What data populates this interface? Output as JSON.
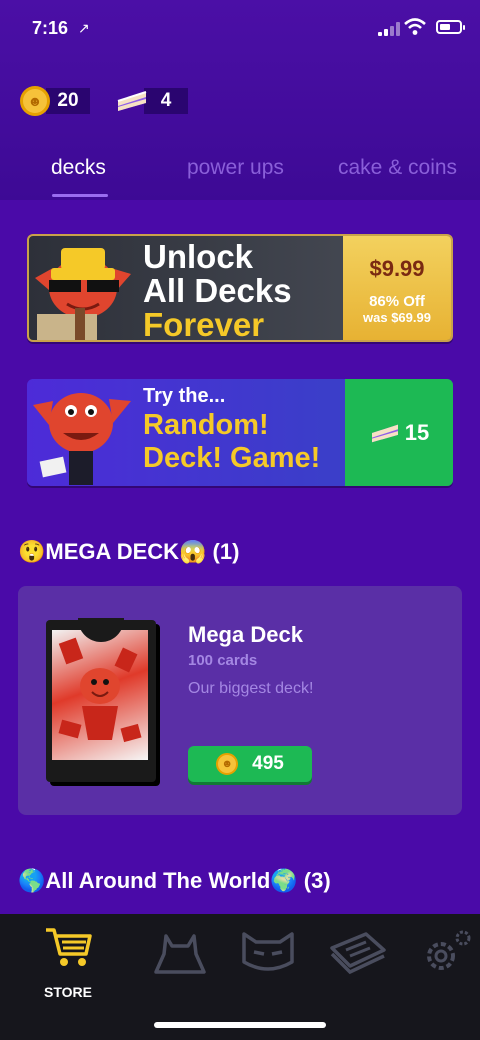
{
  "status_bar": {
    "time": "7:16",
    "location_glyph": "↗"
  },
  "currency": {
    "coins": "20",
    "cake": "4"
  },
  "tabs": [
    {
      "label": "decks",
      "active": true
    },
    {
      "label": "power ups",
      "active": false
    },
    {
      "label": "cake & coins",
      "active": false
    }
  ],
  "banner_unlock": {
    "line1": "Unlock",
    "line2": "All Decks",
    "line3": "Forever",
    "price": "$9.99",
    "discount": "86% Off",
    "was": "was $69.99"
  },
  "banner_random": {
    "try": "Try the...",
    "line1": "Random!",
    "line2": "Deck! Game!",
    "cake_price": "15"
  },
  "sections": {
    "mega": {
      "title": "😲MEGA DECK😱 (1)"
    },
    "world": {
      "title": "🌎All Around The World🌍 (3)"
    }
  },
  "deck": {
    "name": "Mega Deck",
    "cards": "100 cards",
    "description": "Our biggest deck!",
    "price": "495"
  },
  "nav": {
    "store_label": "STORE"
  },
  "colors": {
    "background": "#4a0aa8",
    "accent_gold": "#f5c928",
    "buy_green": "#1db954",
    "nav_active": "#f5c928"
  }
}
